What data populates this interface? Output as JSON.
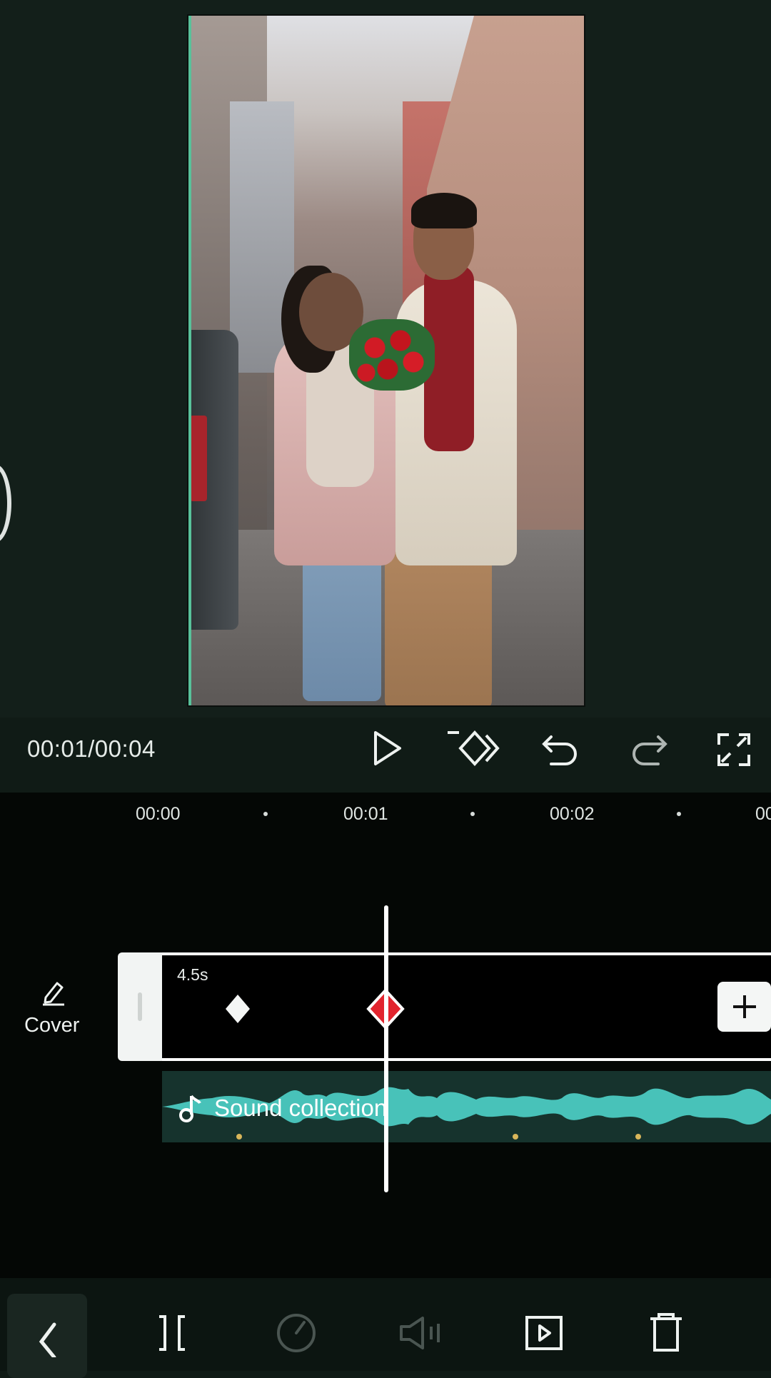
{
  "player": {
    "time_display": "00:01/00:04"
  },
  "ruler": {
    "ticks": [
      "00:00",
      "00:01",
      "00:02",
      "00"
    ]
  },
  "cover": {
    "label": "Cover"
  },
  "video_track": {
    "duration": "4.5s"
  },
  "audio_track": {
    "label": "Sound collection"
  },
  "colors": {
    "accent_teal": "#48c2b9",
    "keyframe_red": "#e2242e",
    "background": "#101b16"
  },
  "icons": {
    "play": "play-icon",
    "keyframe": "keyframe-icon",
    "undo": "undo-icon",
    "redo": "redo-icon",
    "fullscreen": "fullscreen-icon",
    "cover_edit": "pencil-icon",
    "add": "plus-icon",
    "music": "music-note-icon",
    "back": "chevron-left-icon",
    "split": "split-icon",
    "speed": "speed-icon",
    "volume": "volume-icon",
    "animation": "animation-icon",
    "delete": "delete-icon"
  }
}
